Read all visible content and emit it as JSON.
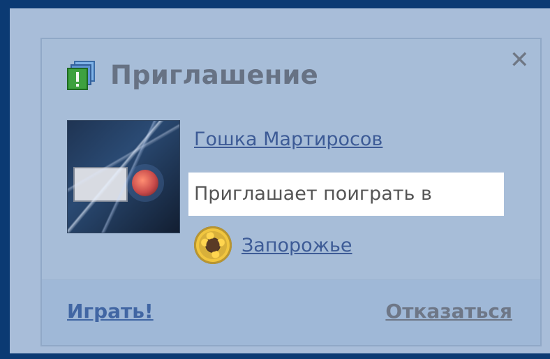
{
  "dialog": {
    "title": "Приглашение",
    "close_icon": "close-icon"
  },
  "invite": {
    "user_name": "Гошка Мартиросов",
    "message": "Приглашает поиграть в",
    "game_name": "Запорожье"
  },
  "icons": {
    "title": "invitation-windows-icon",
    "avatar": "user-avatar",
    "game": "sunflower-game-icon"
  },
  "actions": {
    "play": "Играть!",
    "decline": "Отказаться"
  },
  "colors": {
    "page_background": "#0b3a73",
    "dialog_background": "#a7bdd8",
    "footer_background": "#9fb8d7",
    "title_text": "#677284",
    "link_blue": "#3d5b96",
    "decline_text": "#6e7787"
  }
}
